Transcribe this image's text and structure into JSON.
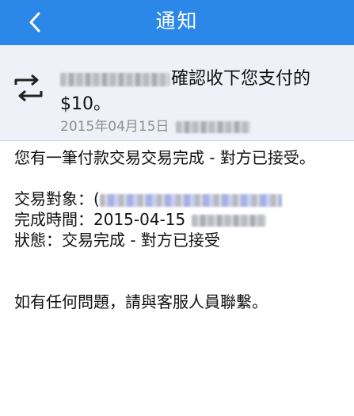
{
  "navbar": {
    "title": "通知",
    "back_icon": "chevron-left-icon"
  },
  "summary": {
    "icon": "transfer-icon",
    "line1_suffix": "確認收下您支付的",
    "amount": "$10。",
    "date": "2015年04月15日"
  },
  "body": {
    "message": "您有一筆付款交易交易完成 - 對方已接受。",
    "counterparty_label": "交易對象：",
    "counterparty_partial": "(",
    "completed_label": "完成時間：",
    "completed_date": "2015-04-15",
    "status_label": "狀態：",
    "status_value": "交易完成 - 對方已接受",
    "contact": "如有任何問題，請與客服人員聯繫。"
  },
  "colors": {
    "navbar": "#2b87e8",
    "summary_bg": "#eef1f7",
    "muted_text": "#8a8f98"
  }
}
